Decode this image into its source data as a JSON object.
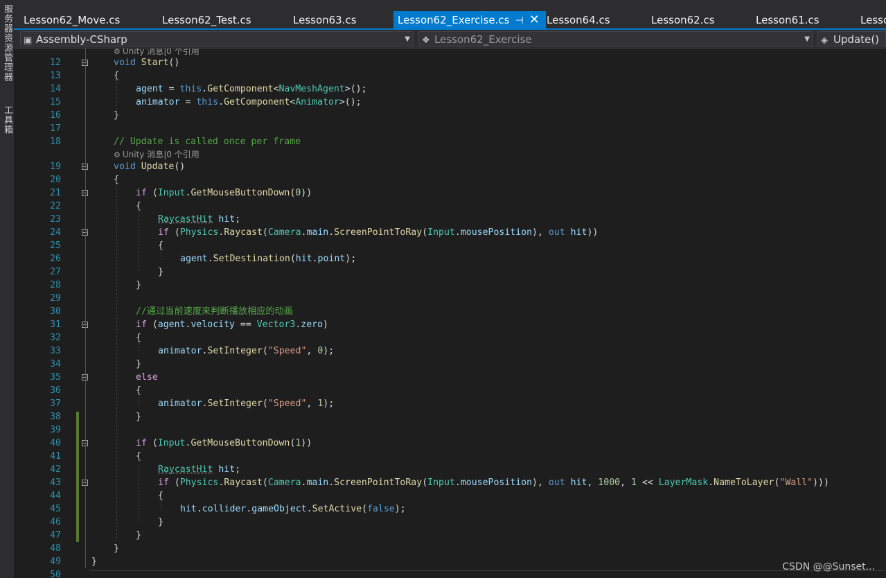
{
  "side_strip": {
    "items": [
      "服务器资源管理器",
      "工具箱"
    ]
  },
  "tabs": [
    {
      "label": "Lesson62_Move.cs",
      "active": false
    },
    {
      "label": "Lesson62_Test.cs",
      "active": false
    },
    {
      "label": "Lesson63.cs",
      "active": false
    },
    {
      "label": "Lesson62_Exercise.cs",
      "active": true
    },
    {
      "label": "Lesson64.cs",
      "active": false
    },
    {
      "label": "Lesson62.cs",
      "active": false
    },
    {
      "label": "Lesson61.cs",
      "active": false
    },
    {
      "label": "Lesso",
      "active": false
    }
  ],
  "navbar": {
    "project": "Assembly-CSharp",
    "class_name": "Lesson62_Exercise",
    "member": "Update()"
  },
  "hints": {
    "start_hint": "Unity 消息|0 个引用",
    "update_hint": "Unity 消息|0 个引用"
  },
  "code_lines": [
    {
      "n": "12",
      "t": [
        [
          "kw",
          "void"
        ],
        [
          "plain",
          " "
        ],
        [
          "fn",
          "Start"
        ],
        [
          "plain",
          "()"
        ]
      ],
      "indent": 0,
      "fold": true
    },
    {
      "n": "13",
      "t": [
        [
          "plain",
          "{"
        ]
      ],
      "indent": 0
    },
    {
      "n": "14",
      "t": [
        [
          "var",
          "agent"
        ],
        [
          "plain",
          " = "
        ],
        [
          "kw",
          "this"
        ],
        [
          "plain",
          "."
        ],
        [
          "fn",
          "GetComponent"
        ],
        [
          "plain",
          "<"
        ],
        [
          "ty",
          "NavMeshAgent"
        ],
        [
          "plain",
          ">();"
        ]
      ],
      "indent": 1
    },
    {
      "n": "15",
      "t": [
        [
          "var",
          "animator"
        ],
        [
          "plain",
          " = "
        ],
        [
          "kw",
          "this"
        ],
        [
          "plain",
          "."
        ],
        [
          "fn",
          "GetComponent"
        ],
        [
          "plain",
          "<"
        ],
        [
          "ty",
          "Animator"
        ],
        [
          "plain",
          ">();"
        ]
      ],
      "indent": 1
    },
    {
      "n": "16",
      "t": [
        [
          "plain",
          "}"
        ]
      ],
      "indent": 0
    },
    {
      "n": "17",
      "t": [],
      "indent": 0
    },
    {
      "n": "18",
      "t": [
        [
          "com",
          "// Update is called once per frame"
        ]
      ],
      "indent": 0
    },
    {
      "n": "19",
      "t": [
        [
          "kw",
          "void"
        ],
        [
          "plain",
          " "
        ],
        [
          "fn",
          "Update"
        ],
        [
          "plain",
          "()"
        ]
      ],
      "indent": 0,
      "fold": true
    },
    {
      "n": "20",
      "t": [
        [
          "plain",
          "{"
        ]
      ],
      "indent": 0
    },
    {
      "n": "21",
      "t": [
        [
          "ctl",
          "if"
        ],
        [
          "plain",
          " ("
        ],
        [
          "ty",
          "Input"
        ],
        [
          "plain",
          "."
        ],
        [
          "fn",
          "GetMouseButtonDown"
        ],
        [
          "plain",
          "("
        ],
        [
          "num",
          "0"
        ],
        [
          "plain",
          "))"
        ]
      ],
      "indent": 1,
      "fold": true
    },
    {
      "n": "22",
      "t": [
        [
          "plain",
          "{"
        ]
      ],
      "indent": 1
    },
    {
      "n": "23",
      "t": [
        [
          "ty squig",
          "RaycastHit"
        ],
        [
          "plain",
          " "
        ],
        [
          "var",
          "hit"
        ],
        [
          "plain",
          ";"
        ]
      ],
      "indent": 2
    },
    {
      "n": "24",
      "t": [
        [
          "ctl",
          "if"
        ],
        [
          "plain",
          " ("
        ],
        [
          "ty",
          "Physics"
        ],
        [
          "plain",
          "."
        ],
        [
          "fn",
          "Raycast"
        ],
        [
          "plain",
          "("
        ],
        [
          "ty",
          "Camera"
        ],
        [
          "plain",
          "."
        ],
        [
          "var",
          "main"
        ],
        [
          "plain",
          "."
        ],
        [
          "fn",
          "ScreenPointToRay"
        ],
        [
          "plain",
          "("
        ],
        [
          "ty",
          "Input"
        ],
        [
          "plain",
          "."
        ],
        [
          "var",
          "mousePosition"
        ],
        [
          "plain",
          "), "
        ],
        [
          "kw",
          "out"
        ],
        [
          "plain",
          " "
        ],
        [
          "var",
          "hit"
        ],
        [
          "plain",
          "))"
        ]
      ],
      "indent": 2,
      "fold": true
    },
    {
      "n": "25",
      "t": [
        [
          "plain",
          "{"
        ]
      ],
      "indent": 2
    },
    {
      "n": "26",
      "t": [
        [
          "var",
          "agent"
        ],
        [
          "plain",
          "."
        ],
        [
          "fn",
          "SetDestination"
        ],
        [
          "plain",
          "("
        ],
        [
          "var",
          "hit"
        ],
        [
          "plain",
          "."
        ],
        [
          "var",
          "point"
        ],
        [
          "plain",
          ");"
        ]
      ],
      "indent": 3
    },
    {
      "n": "27",
      "t": [
        [
          "plain",
          "}"
        ]
      ],
      "indent": 2
    },
    {
      "n": "28",
      "t": [
        [
          "plain",
          "}"
        ]
      ],
      "indent": 1
    },
    {
      "n": "29",
      "t": [],
      "indent": 0
    },
    {
      "n": "30",
      "t": [
        [
          "com",
          "//通过当前速度来判断播放相应的动画"
        ]
      ],
      "indent": 1
    },
    {
      "n": "31",
      "t": [
        [
          "ctl",
          "if"
        ],
        [
          "plain",
          " ("
        ],
        [
          "var",
          "agent"
        ],
        [
          "plain",
          "."
        ],
        [
          "var",
          "velocity"
        ],
        [
          "plain",
          " == "
        ],
        [
          "ty",
          "Vector3"
        ],
        [
          "plain",
          "."
        ],
        [
          "var",
          "zero"
        ],
        [
          "plain",
          ")"
        ]
      ],
      "indent": 1,
      "fold": true
    },
    {
      "n": "32",
      "t": [
        [
          "plain",
          "{"
        ]
      ],
      "indent": 1
    },
    {
      "n": "33",
      "t": [
        [
          "var",
          "animator"
        ],
        [
          "plain",
          "."
        ],
        [
          "fn",
          "SetInteger"
        ],
        [
          "plain",
          "("
        ],
        [
          "str",
          "\"Speed\""
        ],
        [
          "plain",
          ", "
        ],
        [
          "num",
          "0"
        ],
        [
          "plain",
          ");"
        ]
      ],
      "indent": 2
    },
    {
      "n": "34",
      "t": [
        [
          "plain",
          "}"
        ]
      ],
      "indent": 1
    },
    {
      "n": "35",
      "t": [
        [
          "ctl",
          "else"
        ]
      ],
      "indent": 1,
      "fold": true
    },
    {
      "n": "36",
      "t": [
        [
          "plain",
          "{"
        ]
      ],
      "indent": 1
    },
    {
      "n": "37",
      "t": [
        [
          "var",
          "animator"
        ],
        [
          "plain",
          "."
        ],
        [
          "fn",
          "SetInteger"
        ],
        [
          "plain",
          "("
        ],
        [
          "str",
          "\"Speed\""
        ],
        [
          "plain",
          ", "
        ],
        [
          "num",
          "1"
        ],
        [
          "plain",
          ");"
        ]
      ],
      "indent": 2
    },
    {
      "n": "38",
      "t": [
        [
          "plain",
          "}"
        ]
      ],
      "indent": 1
    },
    {
      "n": "39",
      "t": [],
      "indent": 0
    },
    {
      "n": "40",
      "t": [
        [
          "ctl",
          "if"
        ],
        [
          "plain",
          " ("
        ],
        [
          "ty",
          "Input"
        ],
        [
          "plain",
          "."
        ],
        [
          "fn",
          "GetMouseButtonDown"
        ],
        [
          "plain",
          "("
        ],
        [
          "num",
          "1"
        ],
        [
          "plain",
          "))"
        ]
      ],
      "indent": 1,
      "fold": true
    },
    {
      "n": "41",
      "t": [
        [
          "plain",
          "{"
        ]
      ],
      "indent": 1
    },
    {
      "n": "42",
      "t": [
        [
          "ty squig",
          "RaycastHit"
        ],
        [
          "plain",
          " "
        ],
        [
          "var",
          "hit"
        ],
        [
          "plain",
          ";"
        ]
      ],
      "indent": 2
    },
    {
      "n": "43",
      "t": [
        [
          "ctl",
          "if"
        ],
        [
          "plain",
          " ("
        ],
        [
          "ty",
          "Physics"
        ],
        [
          "plain",
          "."
        ],
        [
          "fn",
          "Raycast"
        ],
        [
          "plain",
          "("
        ],
        [
          "ty",
          "Camera"
        ],
        [
          "plain",
          "."
        ],
        [
          "var",
          "main"
        ],
        [
          "plain",
          "."
        ],
        [
          "fn",
          "ScreenPointToRay"
        ],
        [
          "plain",
          "("
        ],
        [
          "ty",
          "Input"
        ],
        [
          "plain",
          "."
        ],
        [
          "var",
          "mousePosition"
        ],
        [
          "plain",
          "), "
        ],
        [
          "kw",
          "out"
        ],
        [
          "plain",
          " "
        ],
        [
          "var",
          "hit"
        ],
        [
          "plain",
          ", "
        ],
        [
          "num",
          "1000"
        ],
        [
          "plain",
          ", "
        ],
        [
          "num",
          "1"
        ],
        [
          "plain",
          " << "
        ],
        [
          "ty",
          "LayerMask"
        ],
        [
          "plain",
          "."
        ],
        [
          "fn",
          "NameToLayer"
        ],
        [
          "plain",
          "("
        ],
        [
          "str",
          "\"Wall\""
        ],
        [
          "plain",
          ")))"
        ]
      ],
      "indent": 2,
      "fold": true
    },
    {
      "n": "44",
      "t": [
        [
          "plain",
          "{"
        ]
      ],
      "indent": 2
    },
    {
      "n": "45",
      "t": [
        [
          "var",
          "hit"
        ],
        [
          "plain",
          "."
        ],
        [
          "var",
          "collider"
        ],
        [
          "plain",
          "."
        ],
        [
          "var",
          "gameObject"
        ],
        [
          "plain",
          "."
        ],
        [
          "fn",
          "SetActive"
        ],
        [
          "plain",
          "("
        ],
        [
          "kw",
          "false"
        ],
        [
          "plain",
          ");"
        ]
      ],
      "indent": 3
    },
    {
      "n": "46",
      "t": [
        [
          "plain",
          "}"
        ]
      ],
      "indent": 2
    },
    {
      "n": "47",
      "t": [
        [
          "plain",
          "}"
        ]
      ],
      "indent": 1
    },
    {
      "n": "48",
      "t": [
        [
          "plain",
          "}"
        ]
      ],
      "indent": 0
    },
    {
      "n": "49",
      "t": [
        [
          "plain",
          "}"
        ]
      ],
      "indent": -1
    },
    {
      "n": "50",
      "t": [],
      "indent": 0
    }
  ],
  "watermark": "CSDN @@Sunset...",
  "colors": {
    "accent": "#007acc",
    "change_marker": "#577a2e"
  }
}
